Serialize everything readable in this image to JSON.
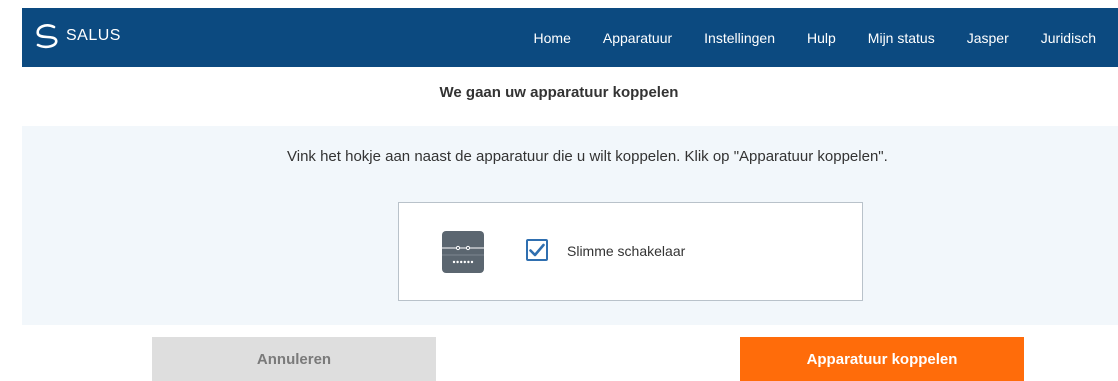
{
  "header": {
    "brand": "SALUS",
    "nav": [
      {
        "label": "Home"
      },
      {
        "label": "Apparatuur"
      },
      {
        "label": "Instellingen"
      },
      {
        "label": "Hulp"
      },
      {
        "label": "Mijn status"
      },
      {
        "label": "Jasper"
      },
      {
        "label": "Juridisch"
      }
    ]
  },
  "main": {
    "title": "We gaan uw apparatuur koppelen",
    "instruction": "Vink het hokje aan naast de apparatuur die u wilt koppelen. Klik op \"Apparatuur koppelen\".",
    "device": {
      "label": "Slimme schakelaar",
      "checked": true,
      "icon": "smart-switch-icon"
    }
  },
  "actions": {
    "cancel_label": "Annuleren",
    "pair_label": "Apparatuur koppelen"
  },
  "colors": {
    "nav_bg": "#0c4a80",
    "panel_bg": "#f2f7fb",
    "primary_button": "#ff6c0a",
    "secondary_button": "#dedede",
    "checkbox": "#2f6fb0"
  }
}
